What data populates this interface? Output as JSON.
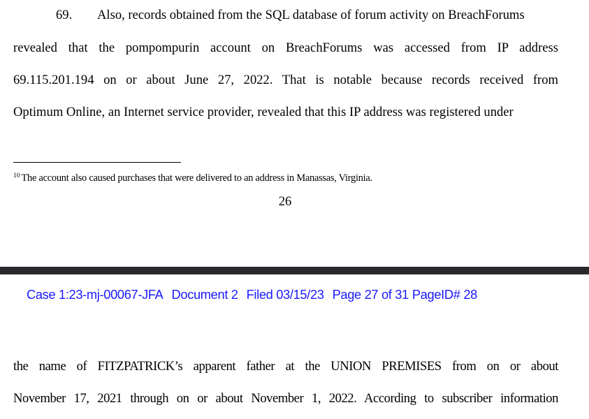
{
  "page_top": {
    "paragraph_number": "69.",
    "lines": [
      "Also, records obtained from the SQL database of forum activity on BreachForums",
      "revealed that the pompompurin account on BreachForums was accessed from IP address",
      "69.115.201.194 on or about June 27, 2022.  That is notable because records received from",
      "Optimum Online, an Internet service provider, revealed that this IP address was registered under"
    ],
    "footnote": {
      "marker": "10",
      "text": "The account also caused purchases that were delivered to an address in Manassas, Virginia."
    },
    "page_number": "26"
  },
  "filing_header": {
    "case": "Case 1:23-mj-00067-JFA",
    "document": "Document 2",
    "filed": "Filed 03/15/23",
    "page": "Page 27 of 31",
    "page_id": "PageID# 28",
    "color": "#1a1aff"
  },
  "page_bottom": {
    "lines": [
      "the name of FITZPATRICK’s apparent father at the UNION PREMISES from on or about",
      "November 17, 2021 through on or about November 1, 2022.  According to subscriber information"
    ]
  }
}
